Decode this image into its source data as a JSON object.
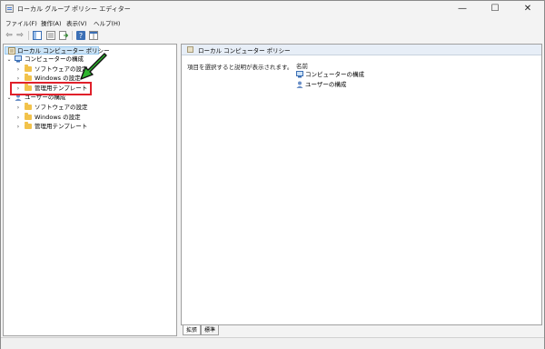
{
  "window": {
    "title": "ローカル グループ ポリシー エディター",
    "controls": {
      "minimize": "—",
      "maximize": "☐",
      "close": "✕"
    }
  },
  "menu": [
    "ファイル(F)",
    "操作(A)",
    "表示(V)",
    "ヘルプ(H)"
  ],
  "toolbar": {
    "icons": [
      "back-arrow-icon",
      "forward-arrow-icon",
      "show-hide-tree-icon",
      "properties-icon",
      "export-list-icon",
      "help-icon",
      "extended-view-icon"
    ]
  },
  "tree": {
    "root": "ローカル コンピューター ポリシー",
    "computer": {
      "label": "コンピューターの構成",
      "children": [
        "ソフトウェアの設定",
        "Windows の設定",
        "管理用テンプレート"
      ]
    },
    "user": {
      "label": "ユーザーの構成",
      "children": [
        "ソフトウェアの設定",
        "Windows の設定",
        "管理用テンプレート"
      ]
    }
  },
  "details": {
    "header": "ローカル コンピューター ポリシー",
    "description": "項目を選択すると説明が表示されます。",
    "column_name": "名前",
    "items": [
      "コンピューターの構成",
      "ユーザーの構成"
    ]
  },
  "tabs": [
    "拡張",
    "標準"
  ],
  "annotation": {
    "arrow_color": "#2fb52f",
    "highlight_color": "#e0202a"
  }
}
